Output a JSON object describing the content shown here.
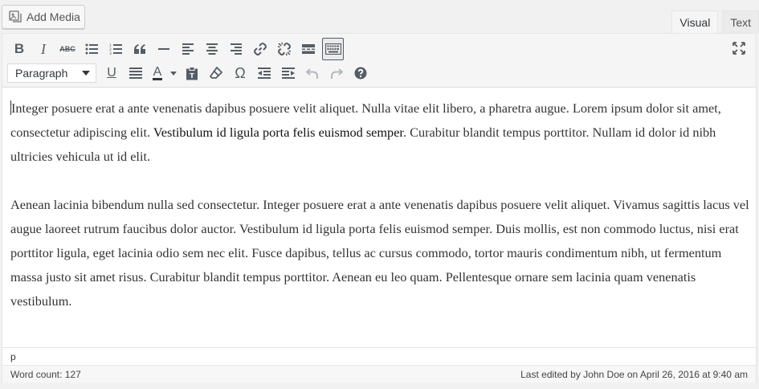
{
  "header": {
    "add_media_label": "Add Media",
    "tabs": [
      {
        "label": "Visual",
        "active": true
      },
      {
        "label": "Text",
        "active": false
      }
    ]
  },
  "toolbar": {
    "row1": [
      "bold",
      "italic",
      "strikethrough",
      "bulleted-list",
      "numbered-list",
      "blockquote",
      "horizontal-line",
      "align-left",
      "align-center",
      "align-right",
      "insert-link",
      "remove-link",
      "read-more-tag",
      "toolbar-toggle"
    ],
    "row2": [
      "underline",
      "justify",
      "text-color",
      "paste-as-text",
      "clear-formatting",
      "special-character",
      "decrease-indent",
      "increase-indent",
      "undo",
      "redo",
      "help"
    ],
    "format_select_value": "Paragraph",
    "bold_label": "B",
    "italic_label": "I",
    "strike_label": "ABC",
    "underline_label": "U",
    "text_color_label": "A",
    "omega_label": "Ω",
    "accent_color": "#555d66"
  },
  "content": {
    "para1_a": "Integer posuere erat a ante venenatis dapibus posuere velit aliquet. Nulla vitae elit libero, a pharetra augue. Lorem ipsum dolor sit amet, consectetur adipiscing elit. ",
    "para1_bold": "Vestibulum id ligula porta felis euismod semper",
    "para1_b": ". Curabitur blandit tempus porttitor. Nullam id dolor id nibh ultricies vehicula ut id elit.",
    "para2": "Aenean lacinia bibendum nulla sed consectetur. Integer posuere erat a ante venenatis dapibus posuere velit aliquet. Vivamus sagittis lacus vel augue laoreet rutrum faucibus dolor auctor. Vestibulum id ligula porta felis euismod semper. Duis mollis, est non commodo luctus, nisi erat porttitor ligula, eget lacinia odio sem nec elit. Fusce dapibus, tellus ac cursus commodo, tortor mauris condimentum nibh, ut fermentum massa justo sit amet risus. Curabitur blandit tempus porttitor. Aenean eu leo quam. Pellentesque ornare sem lacinia quam venenatis vestibulum."
  },
  "status": {
    "element_path": "p",
    "word_count": "Word count: 127",
    "last_edited": "Last edited by John Doe on April 26, 2016 at 9:40 am"
  }
}
